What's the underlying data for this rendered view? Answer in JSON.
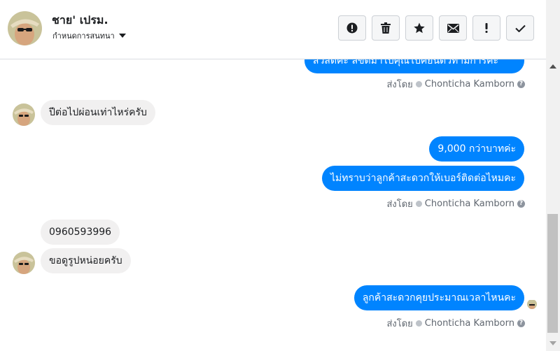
{
  "header": {
    "contact_name": "ชาย' เปรม.",
    "subtitle": "กำหนดการสนทนา",
    "actions": [
      {
        "id": "report",
        "icon": "alert-circle-icon"
      },
      {
        "id": "delete",
        "icon": "trash-icon"
      },
      {
        "id": "star",
        "icon": "star-icon"
      },
      {
        "id": "mark-unread",
        "icon": "envelope-icon"
      },
      {
        "id": "mark-important",
        "icon": "exclamation-icon"
      },
      {
        "id": "done",
        "icon": "check-icon"
      }
    ]
  },
  "messages": {
    "top_partial": "สวัสดีค่ะ ลิขตัมาไปคุณไปคยนติวท่ามการค่ะ",
    "sent_by_1": "ส่งโดย",
    "agent_1": "Chonticha Kamborn",
    "in_1": "ปีต่อไปผ่อนเท่าไหร่ครับ",
    "out_2": "9,000 กว่าบาทค่ะ",
    "out_3": "ไม่ทราบว่าลูกค้าสะดวกให้เบอร์ติดต่อไหมคะ",
    "sent_by_2": "ส่งโดย",
    "agent_2": "Chonticha Kamborn",
    "in_2": "0960593996",
    "in_3": "ขอดูรูปหน่อยครับ",
    "out_4": "ลูกค้าสะดวกคุยประมาณเวลาไหนคะ",
    "sent_by_3": "ส่งโดย",
    "agent_3": "Chonticha Kamborn",
    "help_glyph": "?"
  },
  "colors": {
    "outgoing_bubble": "#0084ff",
    "incoming_bubble": "#f1f0f0",
    "meta_text": "#606770"
  }
}
